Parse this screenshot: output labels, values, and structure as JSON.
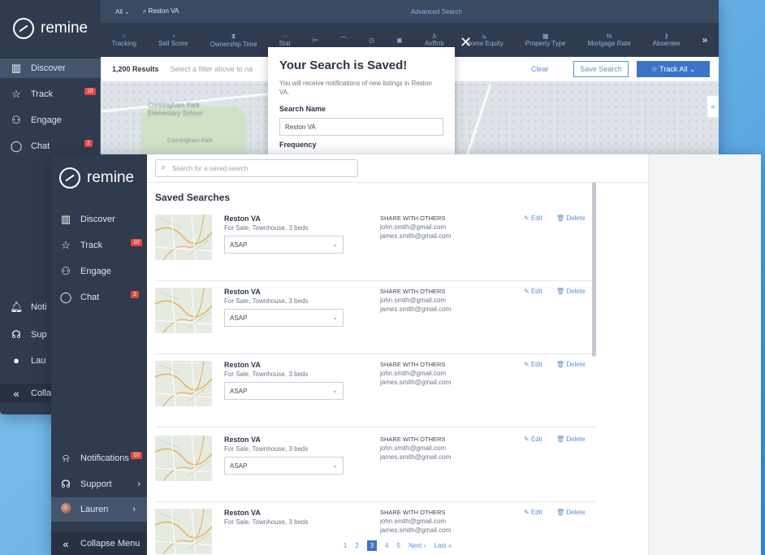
{
  "back": {
    "brand": "remine",
    "topbar": {
      "all_label": "All",
      "search_value": "Reston VA",
      "advanced": "Advanced Search"
    },
    "filters": [
      "Tracking",
      "Sell Score",
      "Ownership Time",
      "Stat",
      "",
      "",
      "",
      "",
      "AirBnb",
      "Home Equity",
      "Property Type",
      "Mortgage Rate",
      "Absentee"
    ],
    "results": {
      "count": "1,200 Results",
      "hint": "Select a filter above to na",
      "clear": "Clear",
      "save_search": "Save Search",
      "track_all": "Track All"
    },
    "sidebar": [
      {
        "label": "Discover",
        "icon": "map-icon"
      },
      {
        "label": "Track",
        "icon": "star-icon",
        "badge": "10"
      },
      {
        "label": "Engage",
        "icon": "people-icon"
      },
      {
        "label": "Chat",
        "icon": "chat-icon",
        "badge": "2"
      }
    ],
    "sidebar_bottom": [
      "Noti",
      "Sup",
      "Lau",
      "Colla"
    ],
    "map_labels": {
      "school": "Cunningham Park Elementary School",
      "park": "Cunningham Park"
    },
    "modal": {
      "title": "Your Search is Saved!",
      "body": "You will receive notifications of new listings in Reston VA.",
      "name_label": "Search Name",
      "name_value": "Reston VA",
      "frequency": "Frequency"
    }
  },
  "front": {
    "brand": "remine",
    "sidebar": [
      {
        "label": "Discover",
        "icon": "map-icon"
      },
      {
        "label": "Track",
        "icon": "star-icon",
        "badge": "10"
      },
      {
        "label": "Engage",
        "icon": "people-icon"
      },
      {
        "label": "Chat",
        "icon": "chat-icon",
        "badge": "2"
      }
    ],
    "sidebar_bottom": [
      {
        "label": "Notifications",
        "icon": "bell-icon",
        "badge": "10"
      },
      {
        "label": "Support",
        "icon": "headset-icon",
        "chevron": "›"
      },
      {
        "label": "Lauren",
        "icon": "avatar",
        "chevron": "›"
      },
      {
        "label": "Collapse Menu",
        "icon": "collapse-icon"
      }
    ],
    "search_placeholder": "Search for a saved search",
    "title": "Saved Searches",
    "rows": [
      {
        "name": "Reston VA",
        "desc": "For Sale, Townhouse, 3 beds",
        "frequency": "ASAP",
        "share": "SHARE WITH OTHERS",
        "emails": [
          "john.smith@gmail.com",
          "james.smith@gmail.com"
        ],
        "edit": "Edit",
        "delete": "Delete"
      },
      {
        "name": "Reston VA",
        "desc": "For Sale, Townhouse, 3 beds",
        "frequency": "ASAP",
        "share": "SHARE WITH OTHERS",
        "emails": [
          "john.smith@gmail.com",
          "james.smith@gmail.com"
        ],
        "edit": "Edit",
        "delete": "Delete"
      },
      {
        "name": "Reston VA",
        "desc": "For Sale, Townhouse, 3 beds",
        "frequency": "ASAP",
        "share": "SHARE WITH OTHERS",
        "emails": [
          "john.smith@gmail.com",
          "james.smith@gmail.com"
        ],
        "edit": "Edit",
        "delete": "Delete"
      },
      {
        "name": "Reston VA",
        "desc": "For Sale, Townhouse, 3 beds",
        "frequency": "ASAP",
        "share": "SHARE WITH OTHERS",
        "emails": [
          "john.smith@gmail.com",
          "james.smith@gmail.com"
        ],
        "edit": "Edit",
        "delete": "Delete"
      },
      {
        "name": "Reston VA",
        "desc": "For Sale, Townhouse, 3 beds",
        "frequency": "",
        "share": "SHARE WITH OTHERS",
        "emails": [
          "john.smith@gmail.com",
          "james.smith@gmail.com"
        ],
        "edit": "Edit",
        "delete": "Delete"
      }
    ],
    "pagination": {
      "pages": [
        "1",
        "2",
        "3",
        "4",
        "5"
      ],
      "current": "3",
      "next": "Next ›",
      "last": "Last »"
    }
  }
}
